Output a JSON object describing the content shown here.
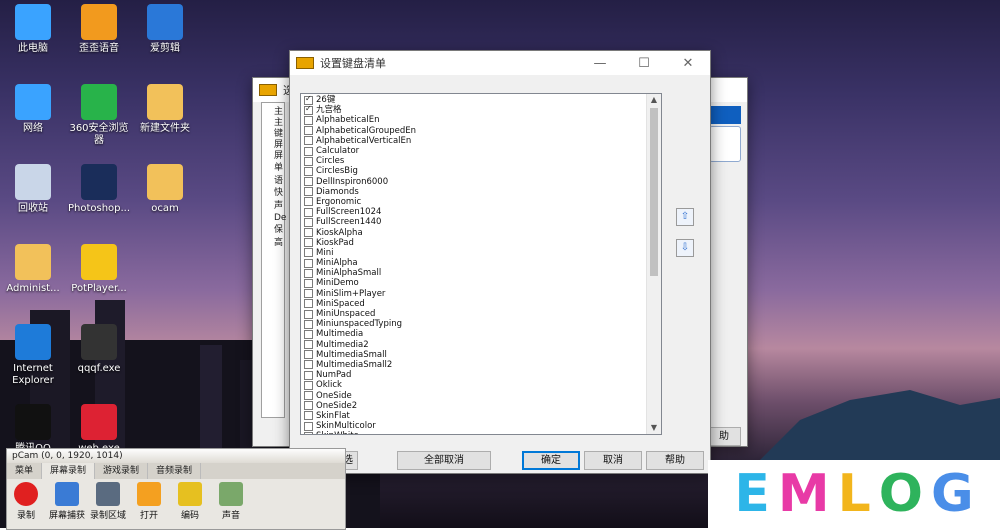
{
  "desktop": {
    "icons": [
      {
        "label": "此电脑",
        "icon": "computer-icon"
      },
      {
        "label": "歪歪语音",
        "icon": "yy-voice-icon"
      },
      {
        "label": "爱剪辑",
        "icon": "video-editor-icon"
      },
      {
        "label": "网络",
        "icon": "network-icon"
      },
      {
        "label": "360安全浏览器",
        "icon": "browser-360-icon"
      },
      {
        "label": "新建文件夹",
        "icon": "folder-icon"
      },
      {
        "label": "回收站",
        "icon": "recycle-bin-icon"
      },
      {
        "label": "Photoshop...",
        "icon": "photoshop-icon"
      },
      {
        "label": "ocam",
        "icon": "folder-icon"
      },
      {
        "label": "Administ...",
        "icon": "user-folder-icon"
      },
      {
        "label": "PotPlayer...",
        "icon": "potplayer-icon"
      },
      {
        "label": "Internet Explorer",
        "icon": "ie-icon"
      },
      {
        "label": "qqqf.exe",
        "icon": "exe-icon"
      },
      {
        "label": "腾讯QQ",
        "icon": "qq-icon"
      },
      {
        "label": "web.exe",
        "icon": "exe-icon"
      }
    ]
  },
  "options_window": {
    "title": "选项",
    "tree_items": [
      "主",
      "主",
      "键",
      "屏",
      "屏",
      "单",
      "语",
      "快",
      "声",
      "De",
      "保",
      "高"
    ],
    "ok_button_fragment": "助"
  },
  "keyboard_dialog": {
    "title": "设置键盘清单",
    "controls": {
      "minimize": "—",
      "maximize": "☐",
      "close": "✕"
    },
    "items": [
      {
        "label": "26键",
        "checked": true
      },
      {
        "label": "九宫格",
        "checked": true
      },
      {
        "label": "AlphabeticalEn",
        "checked": false
      },
      {
        "label": "AlphabeticalGroupedEn",
        "checked": false
      },
      {
        "label": "AlphabeticalVerticalEn",
        "checked": false
      },
      {
        "label": "Calculator",
        "checked": false
      },
      {
        "label": "Circles",
        "checked": false
      },
      {
        "label": "CirclesBig",
        "checked": false
      },
      {
        "label": "DellInspiron6000",
        "checked": false
      },
      {
        "label": "Diamonds",
        "checked": false
      },
      {
        "label": "Ergonomic",
        "checked": false
      },
      {
        "label": "FullScreen1024",
        "checked": false
      },
      {
        "label": "FullScreen1440",
        "checked": false
      },
      {
        "label": "KioskAlpha",
        "checked": false
      },
      {
        "label": "KioskPad",
        "checked": false
      },
      {
        "label": "Mini",
        "checked": false
      },
      {
        "label": "MiniAlpha",
        "checked": false
      },
      {
        "label": "MiniAlphaSmall",
        "checked": false
      },
      {
        "label": "MiniDemo",
        "checked": false
      },
      {
        "label": "MiniSlim+Player",
        "checked": false
      },
      {
        "label": "MiniSpaced",
        "checked": false
      },
      {
        "label": "MiniUnspaced",
        "checked": false
      },
      {
        "label": "MiniunspacedTyping",
        "checked": false
      },
      {
        "label": "Multimedia",
        "checked": false
      },
      {
        "label": "Multimedia2",
        "checked": false
      },
      {
        "label": "MultimediaSmall",
        "checked": false
      },
      {
        "label": "MultimediaSmall2",
        "checked": false
      },
      {
        "label": "NumPad",
        "checked": false
      },
      {
        "label": "Oklick",
        "checked": false
      },
      {
        "label": "OneSide",
        "checked": false
      },
      {
        "label": "OneSide2",
        "checked": false
      },
      {
        "label": "SkinFlat",
        "checked": false
      },
      {
        "label": "SkinMulticolor",
        "checked": false
      },
      {
        "label": "SkinWhite",
        "checked": false
      }
    ],
    "buttons": {
      "select_all_fragment": "选",
      "deselect_all": "全部取消",
      "ok": "确定",
      "cancel": "取消",
      "help": "帮助"
    }
  },
  "bandicam": {
    "title": "pCam (0, 0, 1920, 1014)",
    "tabs": [
      "菜单",
      "屏幕录制",
      "游戏录制",
      "音频录制"
    ],
    "tools": [
      {
        "label": "录制",
        "icon": "record-icon"
      },
      {
        "label": "屏幕捕获",
        "icon": "monitor-icon"
      },
      {
        "label": "录制区域",
        "icon": "region-icon"
      },
      {
        "label": "打开",
        "icon": "folder-open-icon"
      },
      {
        "label": "编码",
        "icon": "encode-icon"
      },
      {
        "label": "声音",
        "icon": "microphone-icon"
      }
    ]
  },
  "logo": {
    "letters": [
      "E",
      "M",
      "L",
      "O",
      "G"
    ],
    "colors": [
      "#2db5e8",
      "#e83aa6",
      "#f2b51c",
      "#2eb35c",
      "#4a8ee8"
    ]
  }
}
